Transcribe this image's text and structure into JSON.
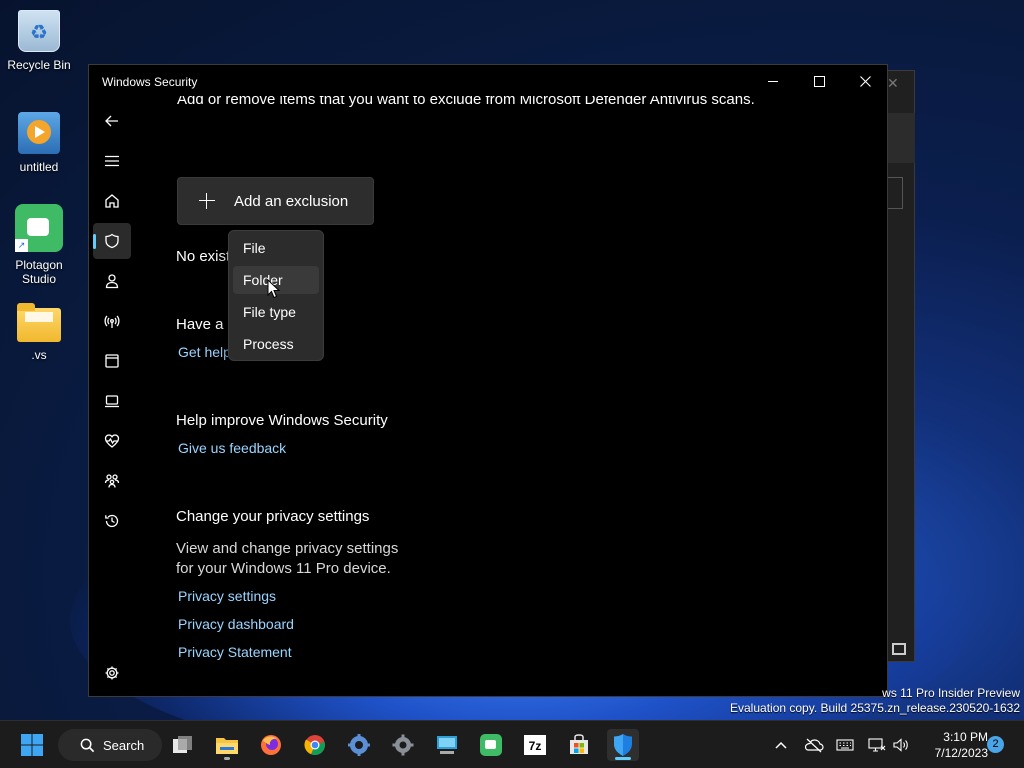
{
  "desktop": {
    "icons": [
      {
        "label": "Recycle Bin"
      },
      {
        "label": "untitled"
      },
      {
        "label": "Plotagon Studio"
      },
      {
        "label": ".vs"
      }
    ]
  },
  "window": {
    "title": "Windows Security",
    "description": "Add or remove items that you want to exclude from Microsoft Defender Antivirus scans.",
    "add_button_label": "Add an exclusion",
    "no_existing_text": "No existing exclusions.",
    "have_question_heading": "Have a question?",
    "get_help_link": "Get help",
    "help_improve_heading": "Help improve Windows Security",
    "feedback_link": "Give us feedback",
    "privacy_heading": "Change your privacy settings",
    "privacy_desc_line1": "View and change privacy settings",
    "privacy_desc_line2": "for your Windows 11 Pro device.",
    "privacy_links": [
      "Privacy settings",
      "Privacy dashboard",
      "Privacy Statement"
    ]
  },
  "nav": {
    "items": [
      {
        "icon": "back-arrow-icon"
      },
      {
        "icon": "hamburger-menu-icon"
      },
      {
        "icon": "home-icon"
      },
      {
        "icon": "shield-icon",
        "selected": true
      },
      {
        "icon": "person-icon"
      },
      {
        "icon": "wireless-antenna-icon"
      },
      {
        "icon": "app-browser-icon"
      },
      {
        "icon": "laptop-icon"
      },
      {
        "icon": "heart-pulse-icon"
      },
      {
        "icon": "family-icon"
      },
      {
        "icon": "history-icon"
      },
      {
        "icon": "settings-gear-icon"
      }
    ]
  },
  "dropdown": {
    "items": [
      "File",
      "Folder",
      "File type",
      "Process"
    ],
    "hovered": "Folder"
  },
  "watermark": {
    "line1": "ws 11 Pro Insider Preview",
    "line2": "Evaluation copy. Build 25375.zn_release.230520-1632"
  },
  "taskbar": {
    "search_label": "Search",
    "time": "3:10 PM",
    "date": "7/12/2023",
    "notification_count": "2",
    "accent": "#60cdff"
  }
}
